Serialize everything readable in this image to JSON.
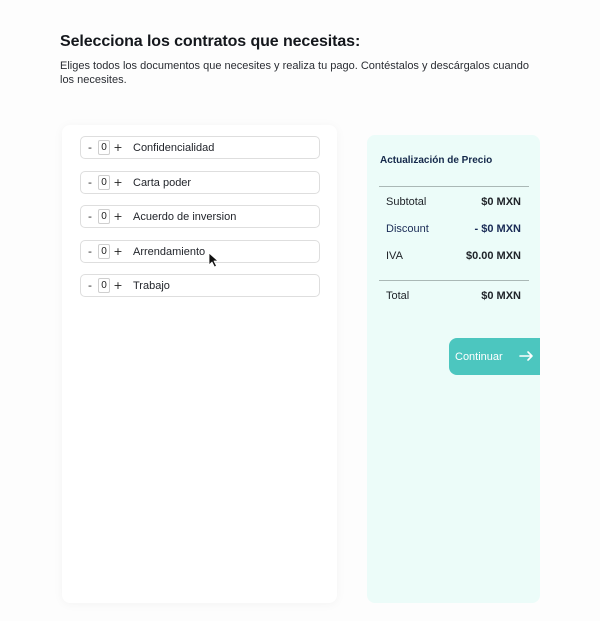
{
  "header": {
    "title": "Selecciona los contratos que necesitas:",
    "subtitle": "Eliges todos los documentos que necesites y realiza tu pago. Contéstalos y descárgalos cuando los necesites."
  },
  "contracts": {
    "minus_label": "-",
    "plus_label": "+",
    "items": [
      {
        "label": "Confidencialidad",
        "qty": "0"
      },
      {
        "label": "Carta poder",
        "qty": "0"
      },
      {
        "label": "Acuerdo de inversion",
        "qty": "0"
      },
      {
        "label": "Arrendamiento",
        "qty": "0"
      },
      {
        "label": "Trabajo",
        "qty": "0"
      }
    ]
  },
  "price": {
    "title": "Actualización de Precio",
    "subtotal_label": "Subtotal",
    "subtotal_value": "$0 MXN",
    "discount_label": "Discount",
    "discount_value": "- $0 MXN",
    "iva_label": "IVA",
    "iva_value": "$0.00 MXN",
    "total_label": "Total",
    "total_value": "$0 MXN"
  },
  "actions": {
    "continue_label": "Continuar"
  },
  "colors": {
    "accent": "#4cc6bf",
    "price_panel_bg": "#ecfcf9",
    "navy_text": "#14284a"
  }
}
